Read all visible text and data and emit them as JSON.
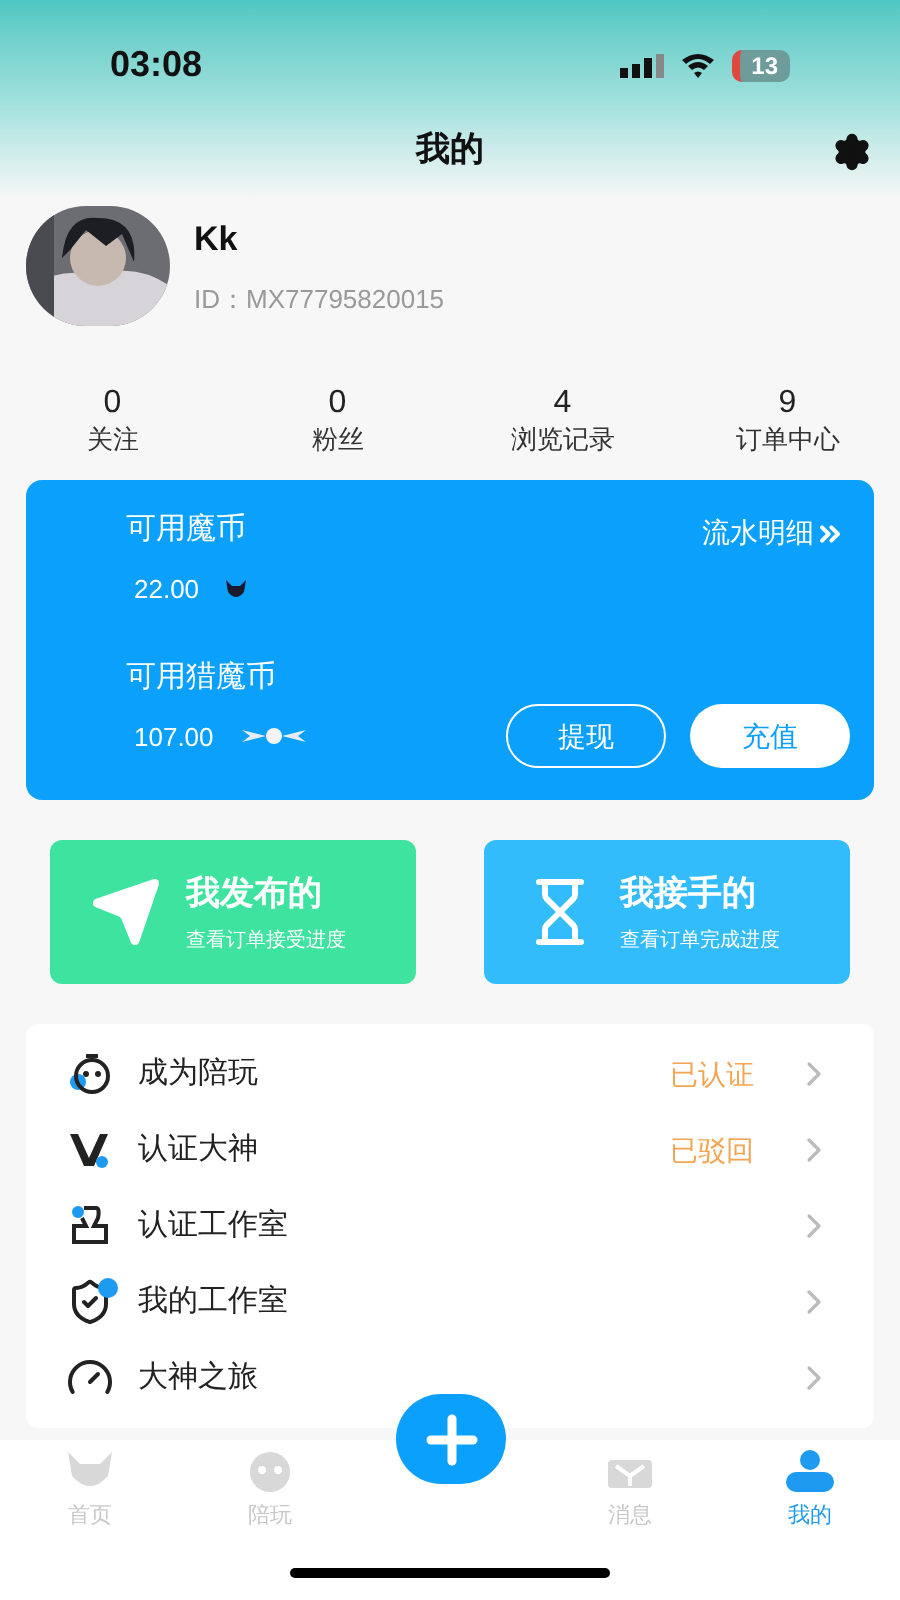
{
  "status_bar": {
    "time": "03:08",
    "battery": "13"
  },
  "header": {
    "title": "我的"
  },
  "profile": {
    "name": "Kk",
    "id": "ID：MX77795820015"
  },
  "stats": [
    {
      "value": "0",
      "label": "关注"
    },
    {
      "value": "0",
      "label": "粉丝"
    },
    {
      "value": "4",
      "label": "浏览记录"
    },
    {
      "value": "9",
      "label": "订单中心"
    }
  ],
  "wallet": {
    "link": "流水明细",
    "balances": [
      {
        "label": "可用魔币",
        "amount": "22.00",
        "kind": "demon"
      },
      {
        "label": "可用猎魔币",
        "amount": "107.00",
        "kind": "wings"
      }
    ],
    "buttons": [
      {
        "label": "提现",
        "kind": "outline"
      },
      {
        "label": "充值",
        "kind": "solid"
      }
    ]
  },
  "shortcuts": [
    {
      "title": "我发布的",
      "subtitle": "查看订单接受进度",
      "kind": "plane",
      "color": "#3de39f"
    },
    {
      "title": "我接手的",
      "subtitle": "查看订单完成进度",
      "kind": "hourglass",
      "color": "#33bcfb"
    }
  ],
  "menu": [
    {
      "label": "成为陪玩",
      "status": "已认证",
      "kind": "face"
    },
    {
      "label": "认证大神",
      "status": "已驳回",
      "kind": "v"
    },
    {
      "label": "认证工作室",
      "kind": "stamp"
    },
    {
      "label": "我的工作室",
      "kind": "shield"
    },
    {
      "label": "大神之旅",
      "kind": "gauge"
    }
  ],
  "tabs": [
    {
      "label": "首页",
      "kind": "home",
      "selected": false
    },
    {
      "label": "陪玩",
      "kind": "play",
      "selected": false
    },
    {
      "label": "消息",
      "kind": "message",
      "selected": false
    },
    {
      "label": "我的",
      "kind": "me",
      "selected": true
    }
  ]
}
